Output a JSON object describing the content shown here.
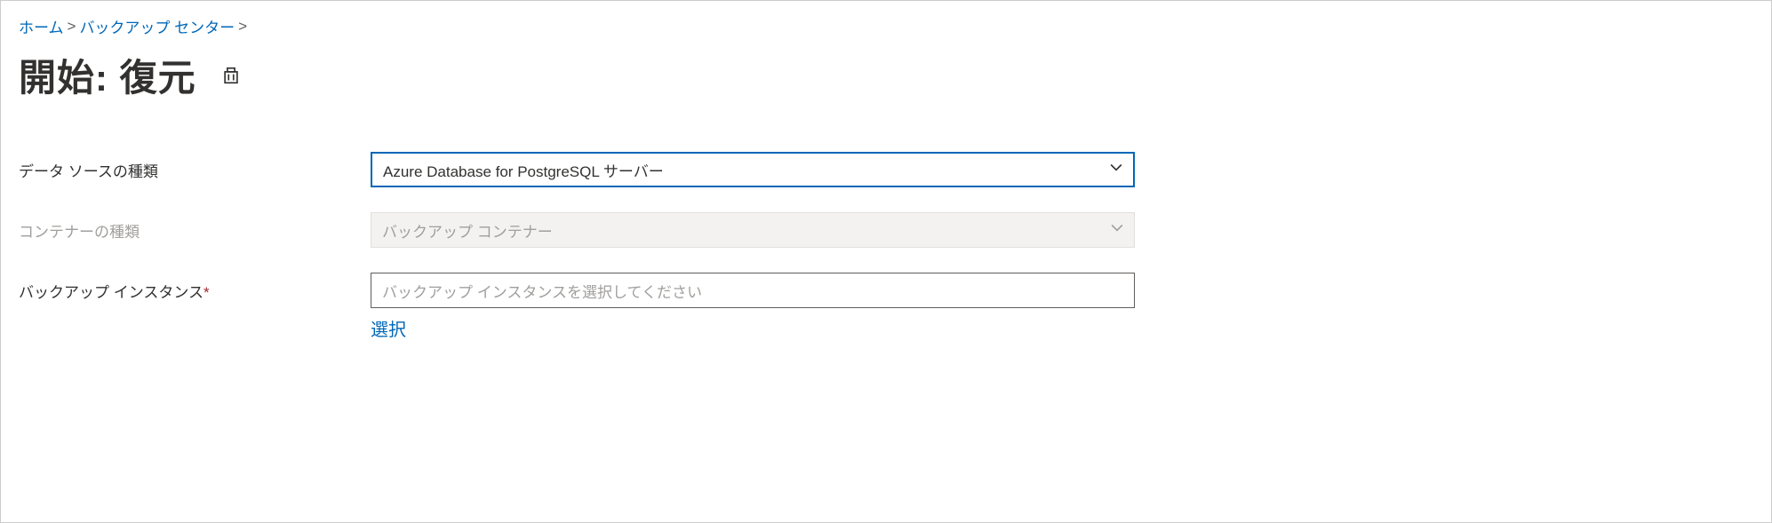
{
  "breadcrumb": {
    "home": "ホーム",
    "backup_center": "バックアップ センター"
  },
  "page_title": "開始: 復元",
  "form": {
    "datasource_type": {
      "label": "データ ソースの種類",
      "value": "Azure Database for PostgreSQL サーバー"
    },
    "container_type": {
      "label": "コンテナーの種類",
      "placeholder": "バックアップ コンテナー"
    },
    "backup_instance": {
      "label": "バックアップ インスタンス",
      "placeholder": "バックアップ インスタンスを選択してください",
      "select_link": "選択"
    }
  }
}
